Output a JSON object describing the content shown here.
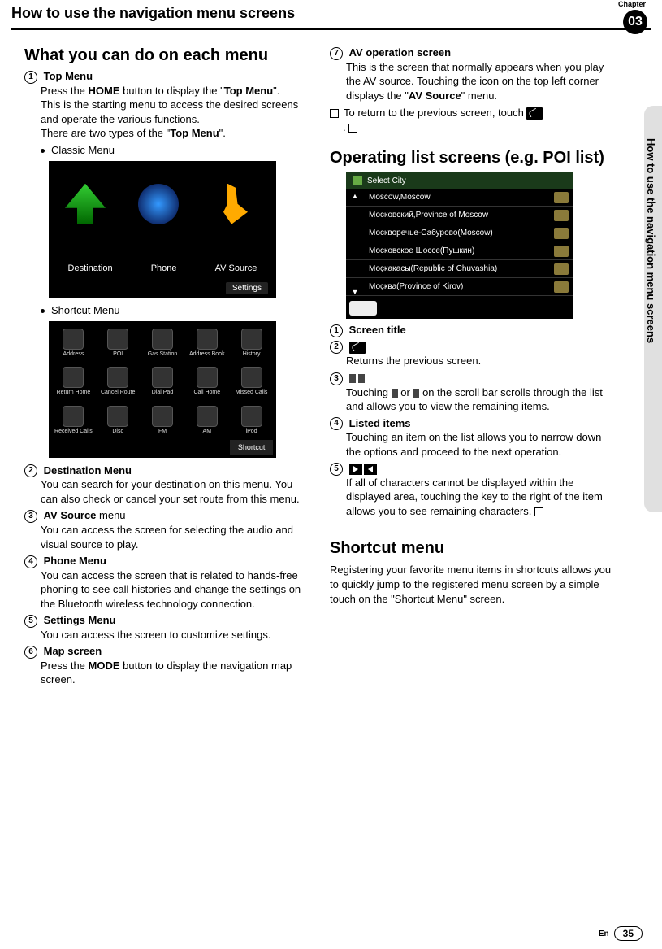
{
  "chapter_label": "Chapter",
  "chapter_number": "03",
  "header_title": "How to use the navigation menu screens",
  "side_text": "How to use the navigation menu screens",
  "left": {
    "section_title": "What you can do on each menu",
    "items": [
      {
        "num": "1",
        "title": "Top Menu",
        "body_pre": "Press the ",
        "bold1": "HOME",
        "body_mid": " button to display the \"",
        "bold2": "Top Menu",
        "body_post": "\".",
        "body2": "This is the starting menu to access the desired screens and operate the various functions.",
        "body3_pre": "There are two types of the \"",
        "body3_bold": "Top Menu",
        "body3_post": "\"."
      }
    ],
    "bullet1": "Classic Menu",
    "classic": {
      "dest": "Destination",
      "phone": "Phone",
      "av": "AV Source",
      "settings": "Settings"
    },
    "bullet2": "Shortcut Menu",
    "shortcut_labels": [
      "Address",
      "POI",
      "Gas Station",
      "Address Book",
      "History",
      "Return Home",
      "Cancel Route",
      "Dial Pad",
      "Call Home",
      "Missed Calls",
      "Received Calls",
      "Disc",
      "FM",
      "AM",
      "iPod"
    ],
    "shortcut_btn": "Shortcut",
    "items2": [
      {
        "num": "2",
        "title": "Destination Menu",
        "body": "You can search for your destination on this menu. You can also check or cancel your set route from this menu."
      },
      {
        "num": "3",
        "title_pre": "AV Source",
        "title_post": " menu",
        "body": "You can access the screen for selecting the audio and visual source to play."
      },
      {
        "num": "4",
        "title": "Phone Menu",
        "body": "You can access the screen that is related to hands-free phoning to see call histories and change the settings on the Bluetooth wireless technology connection."
      },
      {
        "num": "5",
        "title": "Settings Menu",
        "body": "You can access the screen to customize settings."
      },
      {
        "num": "6",
        "title": "Map screen",
        "body_pre": "Press the ",
        "bold": "MODE",
        "body_post": " button to display the navigation map screen."
      }
    ]
  },
  "right": {
    "item7": {
      "num": "7",
      "title": "AV operation screen",
      "body_pre": "This is the screen that normally appears when you play the AV source. Touching the icon on the top left corner displays the \"",
      "bold": "AV Source",
      "body_post": "\" menu."
    },
    "note": "To return to the previous screen, touch ",
    "note_end": ".",
    "section2": "Operating list screens (e.g. POI list)",
    "poi": {
      "title": "Select City",
      "rows": [
        "Moscow,Moscow",
        "Московский,Province of Moscow",
        "Москворечье-Сабурово(Moscow)",
        "Московское Шоссе(Пушкин)",
        "Моçкакасы(Republic of Chuvashia)",
        "Моçква(Province of Kirov)"
      ]
    },
    "list_items": [
      {
        "num": "1",
        "title": "Screen title"
      },
      {
        "num": "2",
        "icon": "back",
        "body": "Returns the previous screen."
      },
      {
        "num": "3",
        "icon": "scroll",
        "body_pre": "Touching ",
        "body_mid": " or ",
        "body_post": " on the scroll bar scrolls through the list and allows you to view the remaining items."
      },
      {
        "num": "4",
        "title": "Listed items",
        "body": "Touching an item on the list allows you to narrow down the options and proceed to the next operation."
      },
      {
        "num": "5",
        "icon": "arrows",
        "body": "If all of characters cannot be displayed within the displayed area, touching the key to the right of the item allows you to see remaining characters."
      }
    ],
    "section3": "Shortcut menu",
    "shortcut_body": "Registering your favorite menu items in shortcuts allows you to quickly jump to the registered menu screen by a simple touch on the \"Shortcut Menu\" screen."
  },
  "footer_lang": "En",
  "footer_page": "35"
}
